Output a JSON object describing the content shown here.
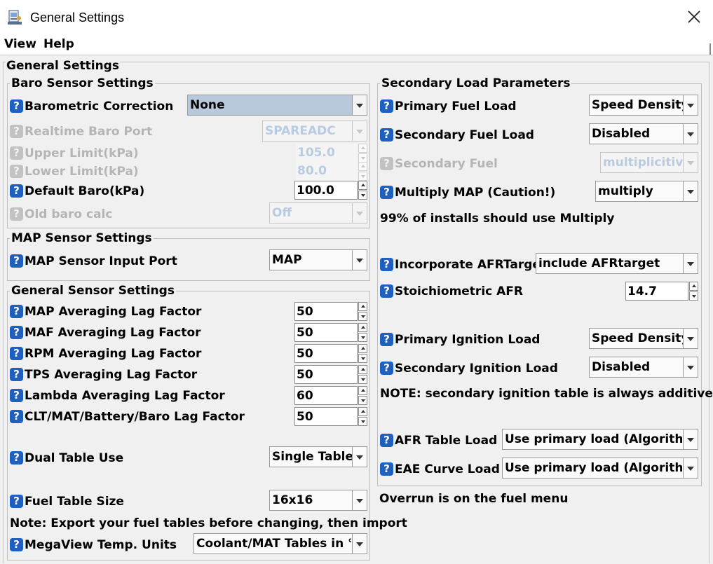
{
  "window": {
    "title": "General Settings"
  },
  "menu": {
    "view": "View",
    "help": "Help"
  },
  "outer": {
    "title": "General Settings"
  },
  "help_glyph": "?",
  "baro": {
    "title": "Baro Sensor Settings",
    "barometric_correction": {
      "label": "Barometric Correction",
      "value": "None"
    },
    "realtime_baro_port": {
      "label": "Realtime Baro Port",
      "value": "SPAREADC"
    },
    "upper_limit": {
      "label": "Upper Limit(kPa)",
      "value": "105.0"
    },
    "lower_limit": {
      "label": "Lower Limit(kPa)",
      "value": "80.0"
    },
    "default_baro": {
      "label": "Default Baro(kPa)",
      "value": "100.0"
    },
    "old_baro_calc": {
      "label": "Old baro calc",
      "value": "Off"
    }
  },
  "map": {
    "title": "MAP Sensor Settings",
    "input_port": {
      "label": "MAP Sensor Input Port",
      "value": "MAP"
    }
  },
  "general_sensor": {
    "title": "General Sensor Settings",
    "rows": [
      {
        "label": "MAP Averaging Lag Factor",
        "value": "50"
      },
      {
        "label": "MAF Averaging Lag Factor",
        "value": "50"
      },
      {
        "label": "RPM Averaging Lag Factor",
        "value": "50"
      },
      {
        "label": "TPS Averaging Lag Factor",
        "value": "50"
      },
      {
        "label": "Lambda Averaging Lag Factor",
        "value": "60"
      },
      {
        "label": "CLT/MAT/Battery/Baro Lag Factor",
        "value": "50"
      }
    ],
    "dual_table_use": {
      "label": "Dual Table Use",
      "value": "Single Table"
    },
    "fuel_table_size": {
      "label": "Fuel Table Size",
      "value": "16x16"
    },
    "note": "Note: Export your fuel tables before changing, then import",
    "megaview_temp_units": {
      "label": "MegaView Temp. Units",
      "value": "Coolant/MAT Tables in °F"
    }
  },
  "secondary": {
    "title": "Secondary Load Parameters",
    "primary_fuel_load": {
      "label": "Primary Fuel Load",
      "value": "Speed Density"
    },
    "secondary_fuel_load": {
      "label": "Secondary Fuel Load",
      "value": "Disabled"
    },
    "secondary_fuel": {
      "label": "Secondary Fuel",
      "value": "multiplicitive"
    },
    "multiply_map": {
      "label": "Multiply MAP (Caution!)",
      "value": "multiply"
    },
    "note_multiply": "99% of installs should use Multiply",
    "incorporate_afrtarget": {
      "label": "Incorporate AFRTarget",
      "value": "include AFRtarget"
    },
    "stoich_afr": {
      "label": "Stoichiometric AFR",
      "value": "14.7"
    },
    "primary_ignition_load": {
      "label": "Primary Ignition Load",
      "value": "Speed Density"
    },
    "secondary_ignition_load": {
      "label": "Secondary Ignition Load",
      "value": "Disabled"
    },
    "note_ignition": "NOTE: secondary ignition table is always additive",
    "afr_table_load": {
      "label": "AFR Table Load",
      "value": "Use primary load (Algorithm)"
    },
    "eae_curve_load": {
      "label": "EAE Curve Load",
      "value": "Use primary load (Algorithm)"
    }
  },
  "overrun_note": "Overrun is on the fuel menu"
}
